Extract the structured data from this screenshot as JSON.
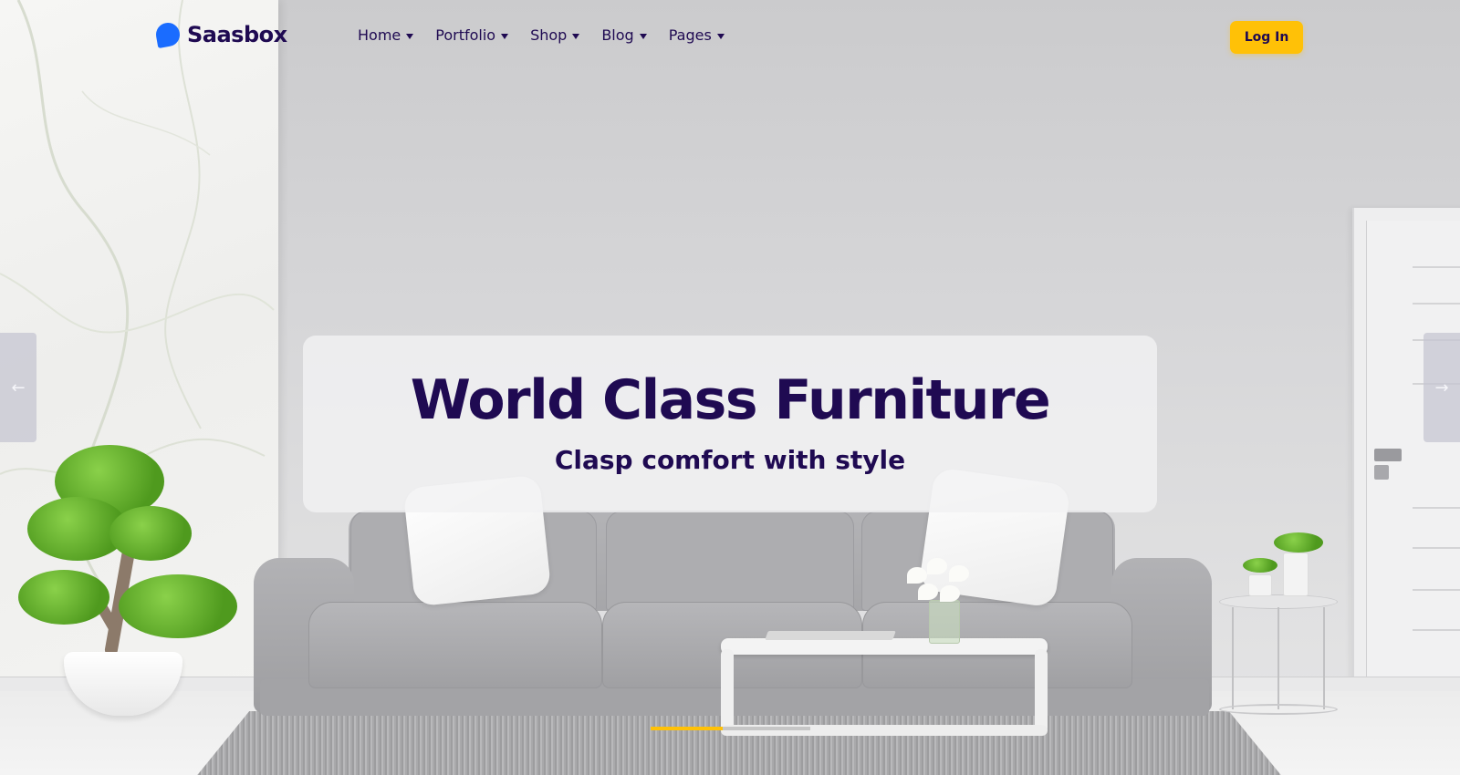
{
  "brand": {
    "name": "Saasbox",
    "logo_color": "#1a6cff"
  },
  "nav": {
    "items": [
      {
        "label": "Home",
        "icon": "caret-down-icon"
      },
      {
        "label": "Portfolio",
        "icon": "caret-down-icon"
      },
      {
        "label": "Shop",
        "icon": "caret-down-icon"
      },
      {
        "label": "Blog",
        "icon": "caret-down-icon"
      },
      {
        "label": "Pages",
        "icon": "caret-down-icon"
      }
    ]
  },
  "header": {
    "login_label": "Log In",
    "login_color": "#ffc107"
  },
  "hero": {
    "title": "World Class Furniture",
    "subtitle": "Clasp comfort with style",
    "text_color": "#1f0a52",
    "prev_icon": "arrow-left-icon",
    "prev_glyph": "←",
    "next_icon": "arrow-right-icon",
    "next_glyph": "→"
  },
  "slider": {
    "progress": 0.45,
    "progress_color": "#ffc107"
  }
}
